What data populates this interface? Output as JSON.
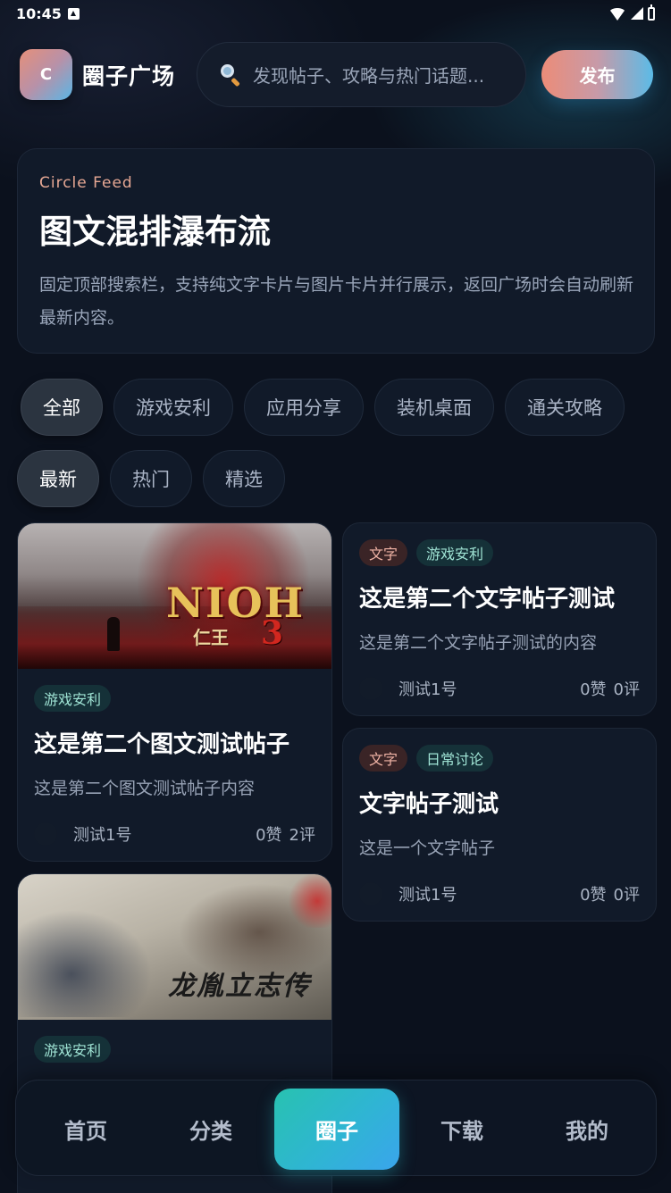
{
  "status_bar": {
    "time": "10:45"
  },
  "header": {
    "logo_letter": "C",
    "title": "圈子广场",
    "search_placeholder": "发现帖子、攻略与热门话题...",
    "publish_label": "发布"
  },
  "hero": {
    "eyebrow": "Circle Feed",
    "title": "图文混排瀑布流",
    "description": "固定顶部搜索栏，支持纯文字卡片与图片卡片并行展示，返回广场时会自动刷新最新内容。"
  },
  "category_chips": [
    {
      "label": "全部",
      "active": true
    },
    {
      "label": "游戏安利",
      "active": false
    },
    {
      "label": "应用分享",
      "active": false
    },
    {
      "label": "装机桌面",
      "active": false
    },
    {
      "label": "通关攻略",
      "active": false
    }
  ],
  "sort_chips": [
    {
      "label": "最新",
      "active": true
    },
    {
      "label": "热门",
      "active": false
    },
    {
      "label": "精选",
      "active": false
    }
  ],
  "posts": [
    {
      "image": {
        "logo_text": "NIOH",
        "logo_sub": "仁王",
        "logo_num": "3"
      },
      "tags": [
        "游戏安利"
      ],
      "title": "这是第二个图文测试帖子",
      "desc": "这是第二个图文测试帖子内容",
      "author": "测试1号",
      "likes": "0赞",
      "comments": "2评"
    },
    {
      "tags": [
        "文字",
        "游戏安利"
      ],
      "title": "这是第二个文字帖子测试",
      "desc": "这是第二个文字帖子测试的内容",
      "author": "测试1号",
      "likes": "0赞",
      "comments": "0评"
    },
    {
      "tags": [
        "文字",
        "日常讨论"
      ],
      "title": "文字帖子测试",
      "desc": "这是一个文字帖子",
      "author": "测试1号",
      "likes": "0赞",
      "comments": "0评"
    },
    {
      "image": {
        "logo_text": "龙胤立志传"
      },
      "tags": [
        "游戏安利"
      ]
    }
  ],
  "bottom_nav": [
    {
      "label": "首页",
      "active": false
    },
    {
      "label": "分类",
      "active": false
    },
    {
      "label": "圈子",
      "active": true
    },
    {
      "label": "下载",
      "active": false
    },
    {
      "label": "我的",
      "active": false
    }
  ],
  "colors": {
    "background": "#0b111d",
    "card": "#111a29",
    "accent_gradient_start": "#ec8c78",
    "accent_gradient_end": "#5bbbe7",
    "nav_active": "#2fb5d3"
  }
}
